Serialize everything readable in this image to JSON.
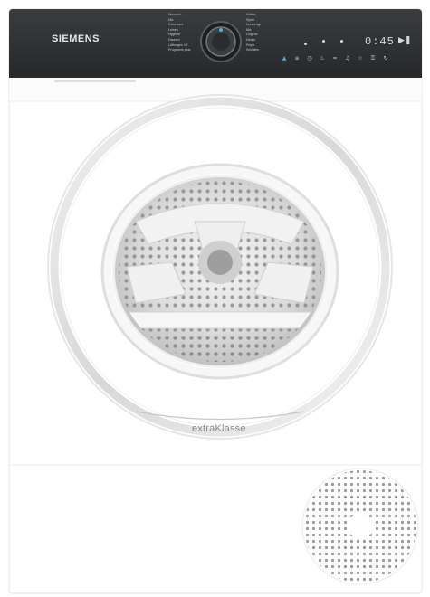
{
  "panel": {
    "brand": "SIEMENS",
    "programs_left": [
      "Schonen",
      "Mix",
      "Extra kurz",
      "Leinen",
      "Hygiene",
      "Daunen",
      "Lüftungen 15'",
      "Programm plus"
    ],
    "programs_right": [
      "Cotton",
      "Synth",
      "Kurzprogr.",
      "Mix",
      "Lingerie",
      "Decke",
      "Pulpo",
      "Schlafen"
    ],
    "time_display": "0:45",
    "start_pause_icon": "start-pause-icon",
    "function_buttons": [
      {
        "icon": "home-connect-icon",
        "active": true
      },
      {
        "icon": "dry-level-icon",
        "active": false
      },
      {
        "icon": "time-icon",
        "active": false
      },
      {
        "icon": "low-heat-icon",
        "active": false
      },
      {
        "icon": "anti-crease-icon",
        "active": false
      },
      {
        "icon": "signal-icon",
        "active": false
      },
      {
        "icon": "favorite-icon",
        "active": false
      },
      {
        "icon": "child-lock-icon",
        "active": false
      },
      {
        "icon": "remote-start-icon",
        "active": false
      }
    ]
  },
  "door": {
    "logo_text": "extraKlasse"
  },
  "colors": {
    "panel": "#2b2e30",
    "body": "#ffffff",
    "ring": "#dcdcdc",
    "accent": "#3fb6d8"
  }
}
